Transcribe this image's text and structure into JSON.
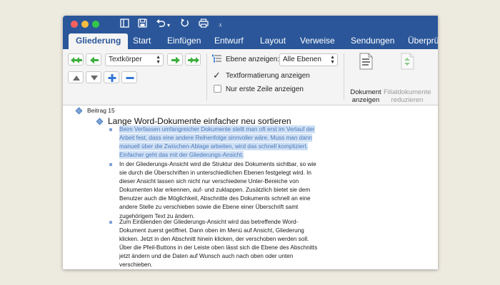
{
  "tabs": [
    {
      "label": "Gliederung",
      "active": true
    },
    {
      "label": "Start"
    },
    {
      "label": "Einfügen"
    },
    {
      "label": "Entwurf"
    },
    {
      "label": "Layout"
    },
    {
      "label": "Verweise"
    },
    {
      "label": "Sendungen"
    },
    {
      "label": "Überprü"
    }
  ],
  "ribbon": {
    "style_select": "Textkörper",
    "level_label": "Ebene anzeigen:",
    "level_select": "Alle Ebenen",
    "show_formatting": {
      "label": "Textformatierung anzeigen",
      "checked": true
    },
    "first_line_only": {
      "label": "Nur erste Zeile anzeigen",
      "checked": false
    },
    "show_document": {
      "line1": "Dokument",
      "line2": "anzeigen"
    },
    "collapse_subdocs": {
      "line1": "Filialdokumente",
      "line2": "reduzieren"
    }
  },
  "document": {
    "item_top": "Beitrag 15",
    "heading": "Lange Word-Dokumente einfacher neu sortieren",
    "paragraphs": [
      "Beim Verfassen umfangreicher Dokumente stellt man oft erst im Verlauf der Arbeit fest, dass eine andere Reihenfolge sinnvoller wäre. Muss man dann manuell über die Zwischen-Ablage arbeiten, wird das schnell kompliziert. Einfacher geht das mit der Gliederungs-Ansicht.",
      "In der Gliederungs-Ansicht wird die Struktur des Dokuments sichtbar, so wie sie durch die Überschriften in unterschiedlichen Ebenen festgelegt wird. In dieser Ansicht lassen sich nicht nur verschiedene Unter-Bereiche von Dokumenten klar erkennen, auf- und zuklappen. Zusätzlich bietet sie dem Benutzer auch die Möglichkeit, Abschnitte des Dokuments schnell an eine andere Stelle zu verschieben sowie die Ebene einer Überschrift samt zugehörigem Text zu ändern.",
      "Zum Einblenden der Gliederungs-Ansicht wird das betreffende Word-Dokument zuerst geöffnet. Dann oben im Menü auf Ansicht, Gliederung klicken. Jetzt in den Abschnitt hinein klicken, der verschoben werden soll. Über die Pfeil-Buttons in der Leiste oben lässt sich die Ebene des Abschnitts jetzt ändern und die Daten auf Wunsch auch nach oben oder unten verschieben."
    ]
  },
  "colors": {
    "brand": "#2b579a",
    "selection": "#cfe0f6",
    "arrow_green": "#3cae3c",
    "plus_minus_blue": "#3277d5"
  }
}
